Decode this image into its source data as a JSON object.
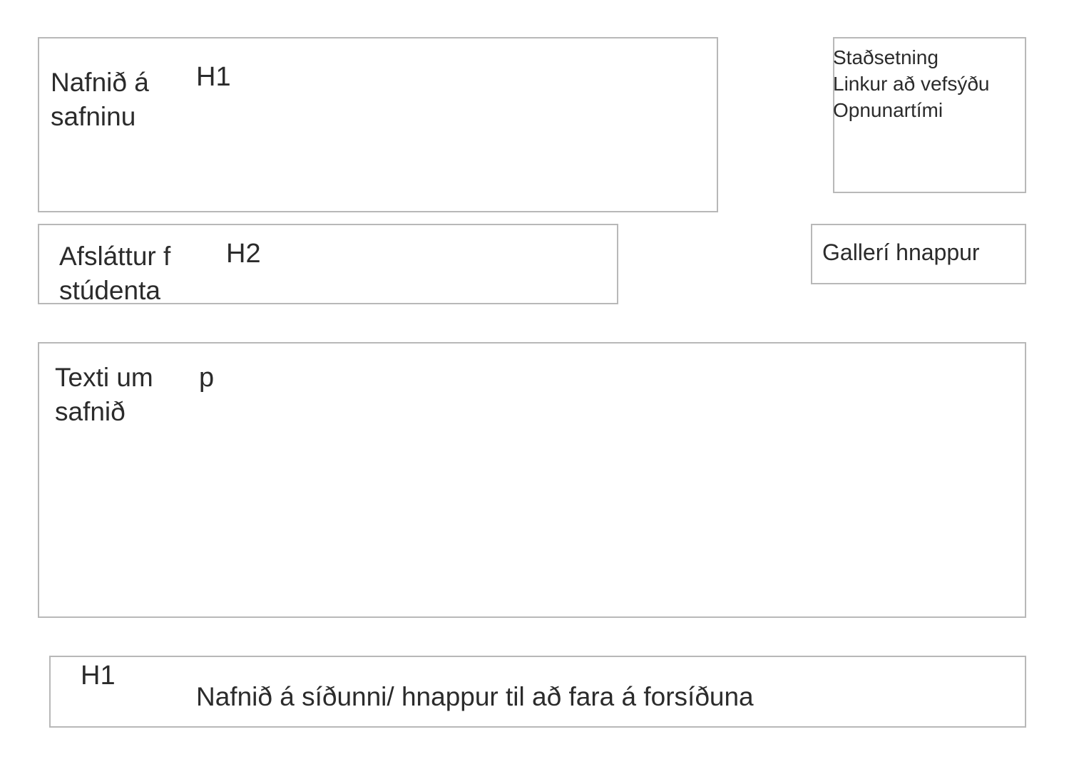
{
  "title_section": {
    "label_line1": "Nafnið á",
    "label_line2": "safninu",
    "tag": "H1"
  },
  "info_section": {
    "lines": [
      "Staðsetning",
      "Linkur að vefsýðu",
      "Opnunartími"
    ]
  },
  "discount_section": {
    "label_line1": "Afsláttur f",
    "label_line2": "stúdenta",
    "tag": "H2"
  },
  "gallery_section": {
    "button_label": "Gallerí hnappur"
  },
  "about_section": {
    "label_line1": "Texti um",
    "label_line2": "safnið",
    "tag": "p"
  },
  "footer_section": {
    "tag": "H1",
    "label": "Nafnið á síðunni/ hnappur til að fara á forsíðuna"
  },
  "colors": {
    "border": "#b8b8b8",
    "text": "#2b2b2b",
    "background": "#ffffff"
  }
}
